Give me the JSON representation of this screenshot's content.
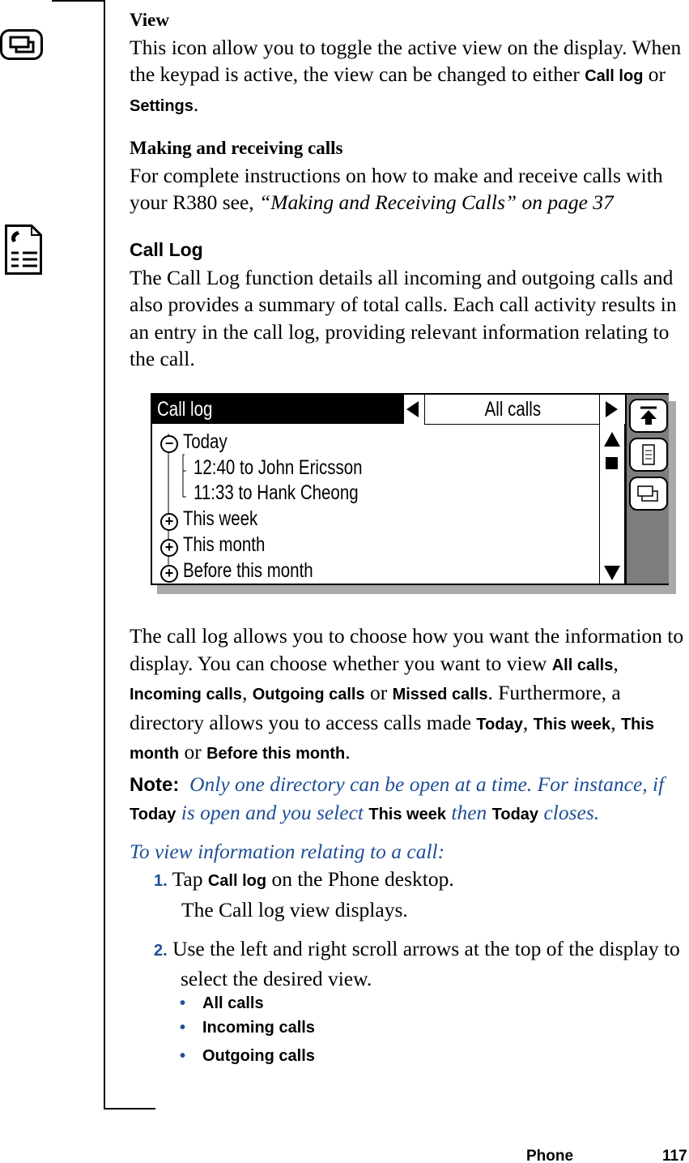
{
  "view_section": {
    "heading": "View",
    "text1": "This icon allow you to toggle the active view on the display. When the keypad is active, the view can be changed to either ",
    "call_log": "Call log",
    "or": " or ",
    "settings": "Settings",
    "end": "."
  },
  "making_section": {
    "heading": "Making and receiving calls",
    "text1": "For complete instructions on how to make and receive calls with your R380 see, ",
    "ref": "“Making and Receiving Calls” on page 37"
  },
  "call_log_section": {
    "heading": "Call Log",
    "text": "The Call Log function details all incoming and outgoing calls and also provides a summary of total calls. Each call activity results in an entry in the call log, providing relevant information relating to the call."
  },
  "screen": {
    "title": "Call log",
    "filter": "All calls",
    "tree": [
      {
        "label": "Today",
        "state": "expanded"
      },
      {
        "label": "12:40 to John Ericsson",
        "child": true
      },
      {
        "label": "11:33 to Hank Cheong",
        "child": true
      },
      {
        "label": "This week",
        "state": "collapsed"
      },
      {
        "label": "This month",
        "state": "collapsed"
      },
      {
        "label": "Before this month",
        "state": "collapsed"
      }
    ],
    "side_icons": [
      "scroll-top-icon",
      "details-icon",
      "toggle-view-icon"
    ]
  },
  "choose_paragraph": {
    "t1": "The call log allows you to choose how you want the information to display. You can choose whether you want to view ",
    "all_calls": "All calls",
    "c1": ", ",
    "incoming": "Incoming calls",
    "c2": ", ",
    "outgoing": "Outgoing calls",
    "or1": " or ",
    "missed": "Missed calls",
    "t2": ". Furthermore, a directory allows you to access calls made ",
    "today": "Today",
    "c3": ", ",
    "this_week": "This week",
    "c4": ", ",
    "this_month": "This month",
    "or2": " or ",
    "before": "Before this month",
    "end": "."
  },
  "note": {
    "label": "Note:",
    "t1": "Only one directory can be open at a time. For instance, if ",
    "today": "Today",
    "t2": " is open and you select ",
    "this_week": "This week",
    "t3": " then ",
    "today2": "Today",
    "t4": " closes."
  },
  "procedure": {
    "heading": "To view information relating to a call:",
    "step1": {
      "num": "1.",
      "t1": "Tap ",
      "bold": "Call log",
      "t2": " on the Phone desktop.",
      "result": "The Call log view displays."
    },
    "step2": {
      "num": "2.",
      "text": "Use the left and right scroll arrows at the top of the display to select the desired view."
    },
    "bullets": [
      "All calls",
      "Incoming calls",
      "Outgoing calls"
    ],
    "bullet_char": "•"
  },
  "footer": {
    "section": "Phone",
    "page": "117"
  },
  "colors": {
    "accent_blue": "#1f4e96"
  }
}
